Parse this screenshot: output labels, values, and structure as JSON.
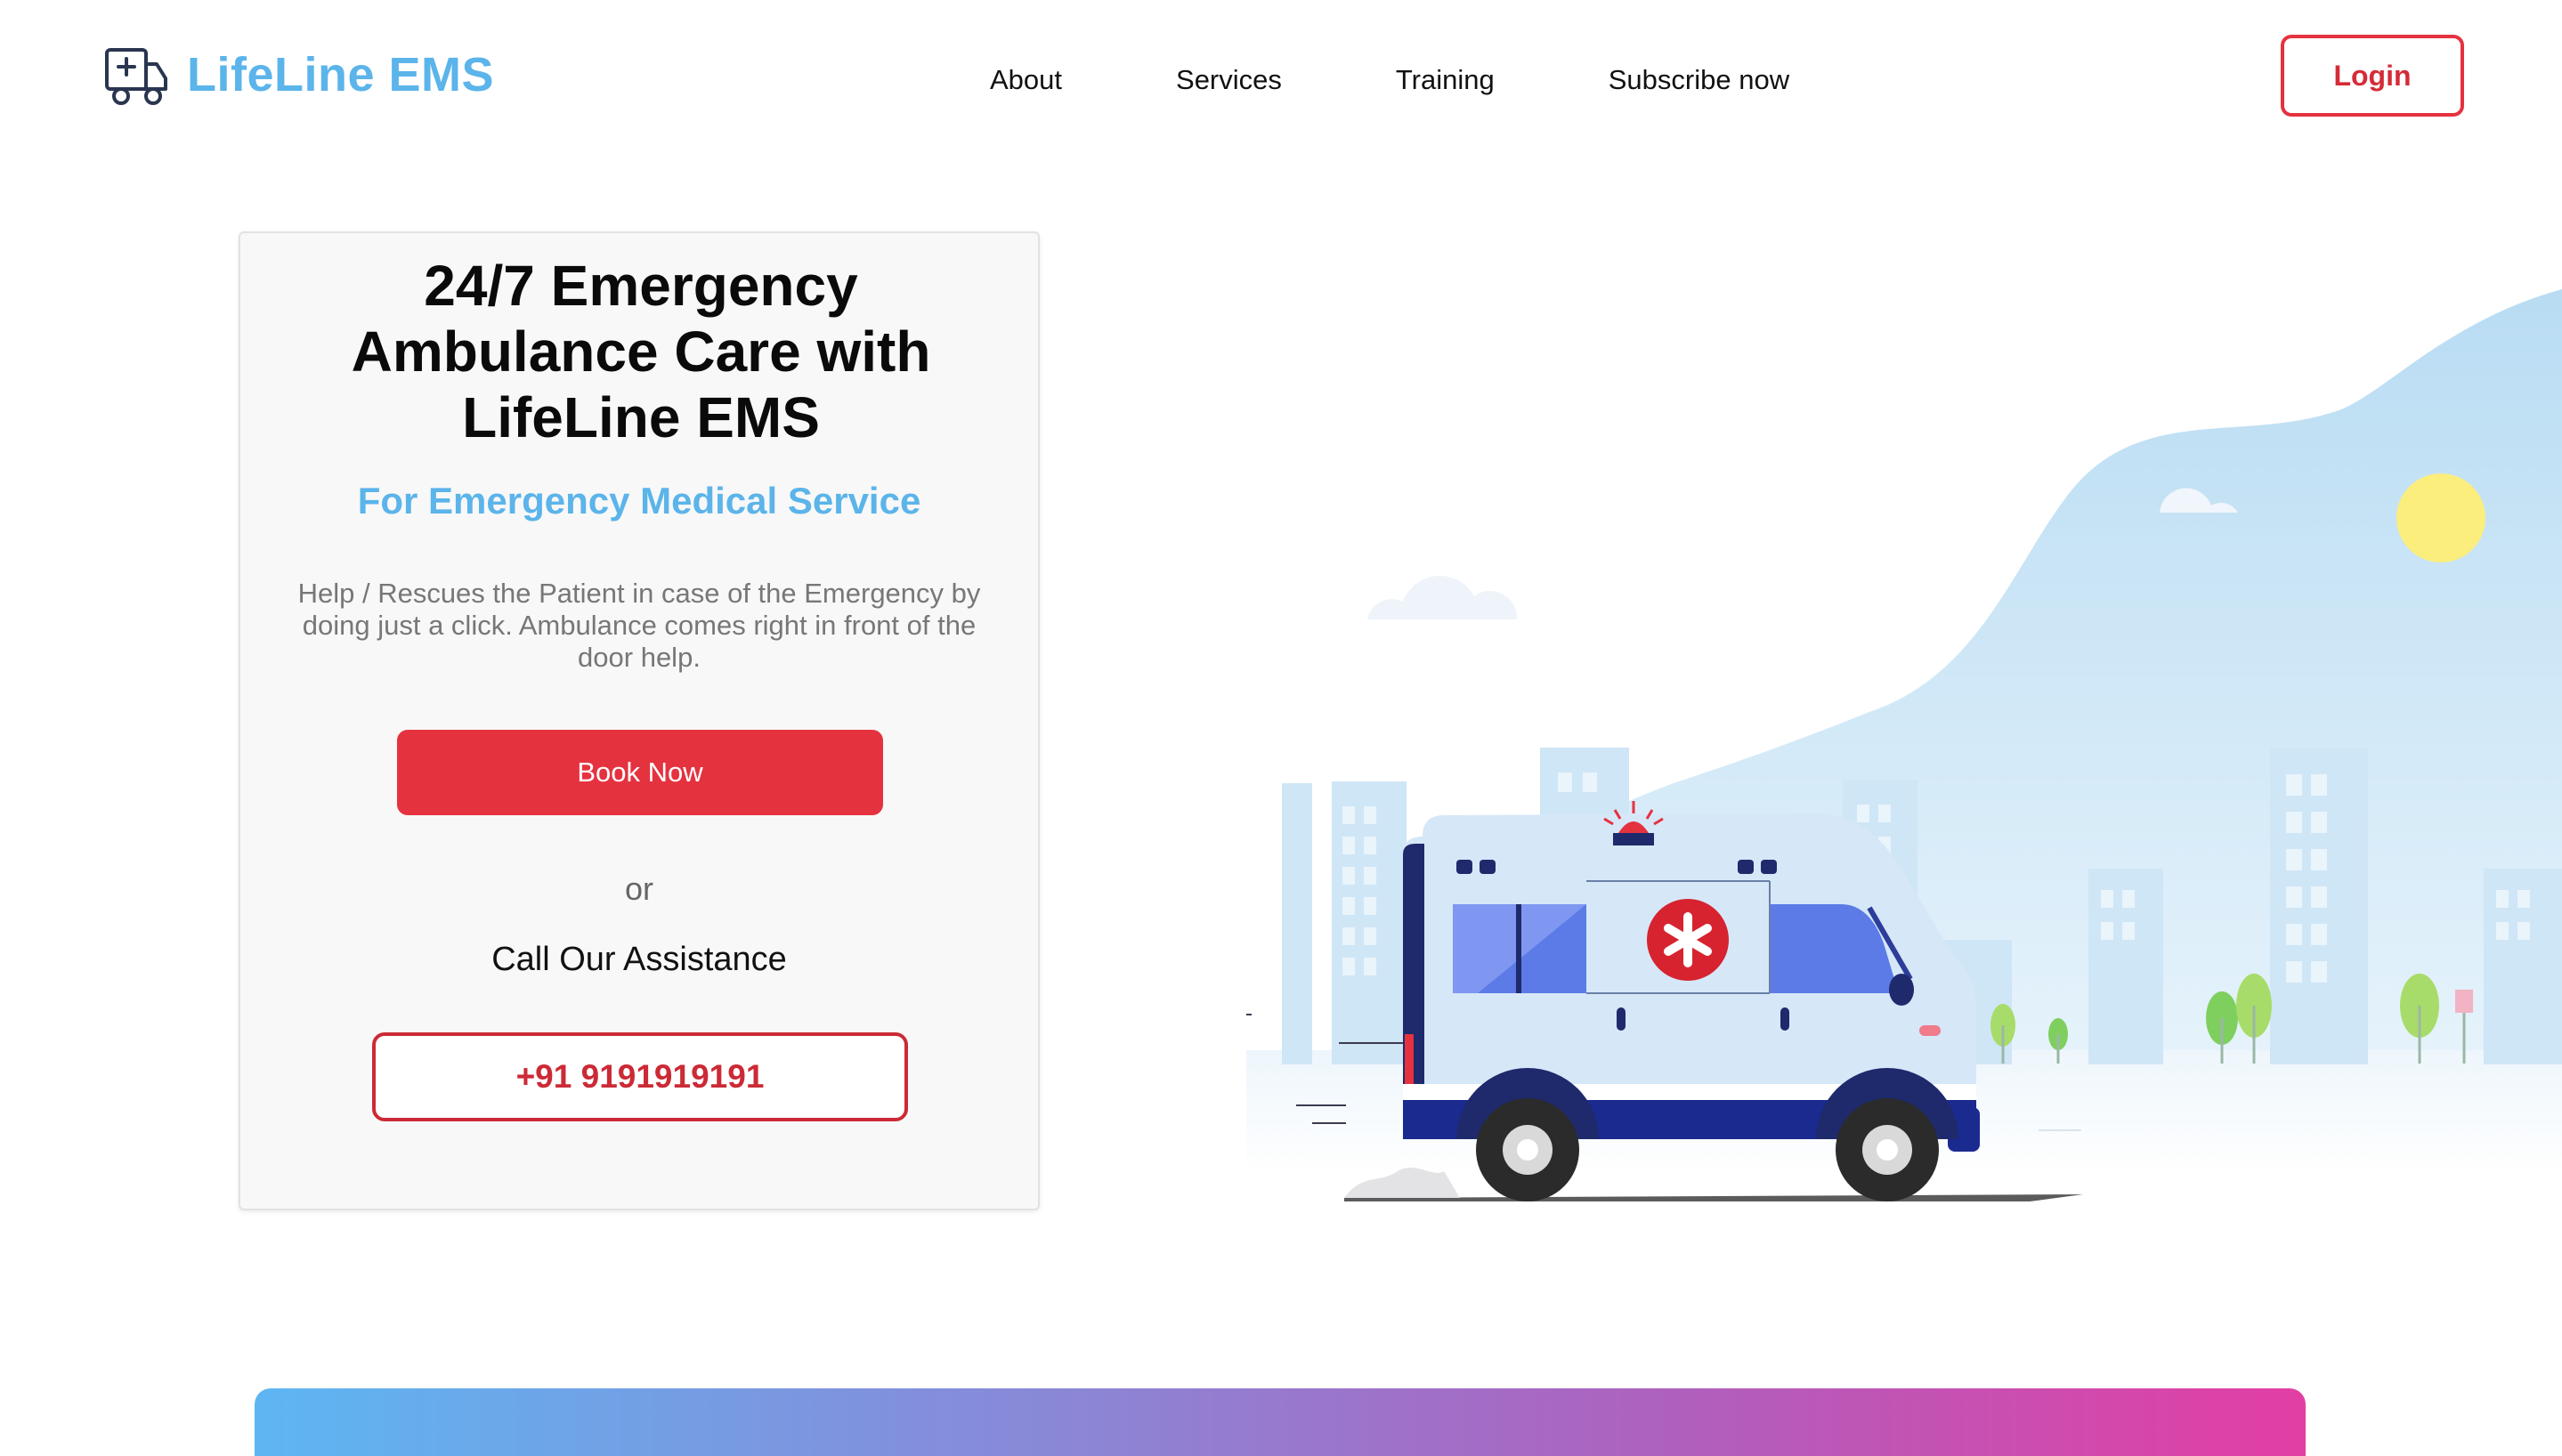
{
  "header": {
    "brand_name": "LifeLine EMS",
    "brand_icon": "ambulance-icon",
    "nav": [
      {
        "label": "About"
      },
      {
        "label": "Services"
      },
      {
        "label": "Training"
      },
      {
        "label": "Subscribe now"
      }
    ],
    "login_label": "Login"
  },
  "hero": {
    "title": "24/7 Emergency Ambulance Care with LifeLine EMS",
    "subtitle": "For Emergency Medical Service",
    "description": "Help / Rescues the Patient in case of the Emergency by doing just a click. Ambulance comes right in front of the door help.",
    "book_label": "Book Now",
    "or_label": "or",
    "call_label": "Call Our Assistance",
    "phone": "+91 9191919191"
  },
  "illustration": {
    "subject": "ambulance-city-illustration"
  },
  "colors": {
    "brand_blue": "#5bb4ea",
    "accent_red": "#e5323f",
    "banner_gradient_start": "#5db6f2",
    "banner_gradient_end": "#e33ea4"
  }
}
